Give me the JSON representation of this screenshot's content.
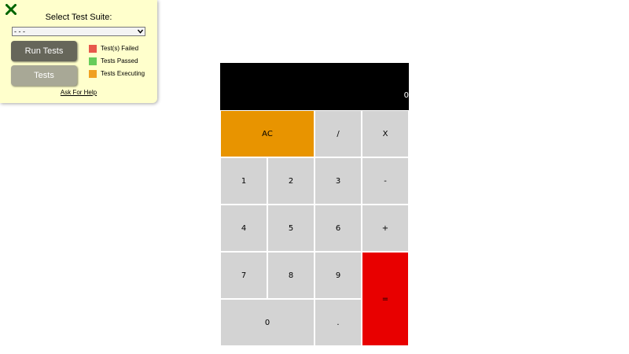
{
  "test_panel": {
    "close_glyph": "✕",
    "suite_label": "Select Test Suite:",
    "suite_selected": "- - -",
    "run_tests_label": "Run Tests",
    "tests_label": "Tests",
    "legend": [
      {
        "label": "Test(s) Failed",
        "color": "#e8584a"
      },
      {
        "label": "Tests Passed",
        "color": "#66cc5a"
      },
      {
        "label": "Tests Executing",
        "color": "#f0a020"
      }
    ],
    "help_label": "Ask For Help",
    "colors": {
      "panel_bg": "#ffffcc",
      "run_btn": "#66665a",
      "tests_btn": "#a8a896",
      "close_icon": "#006400"
    }
  },
  "calculator": {
    "display": "0",
    "keys": {
      "clear": "AC",
      "divide": "/",
      "multiply": "X",
      "subtract": "-",
      "add": "+",
      "equals": "=",
      "decimal": ".",
      "zero": "0",
      "one": "1",
      "two": "2",
      "three": "3",
      "four": "4",
      "five": "5",
      "six": "6",
      "seven": "7",
      "eight": "8",
      "nine": "9"
    },
    "colors": {
      "display_bg": "#000000",
      "clear_bg": "#e89400",
      "equals_bg": "#e80000",
      "key_bg": "#d3d3d3"
    }
  }
}
